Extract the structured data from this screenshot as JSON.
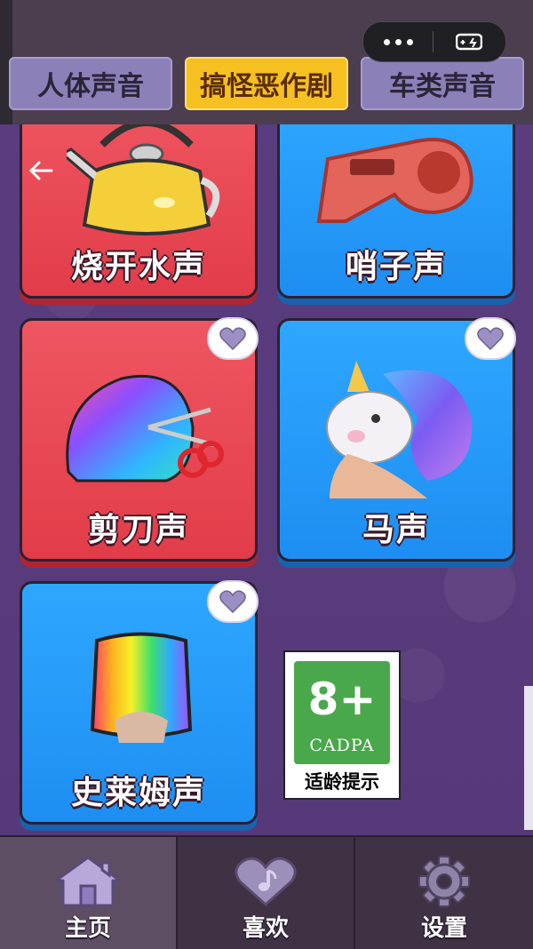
{
  "header": {
    "tabs": [
      {
        "label": "人体声音",
        "active": false
      },
      {
        "label": "搞怪恶作剧",
        "active": true
      },
      {
        "label": "车类声音",
        "active": false
      }
    ],
    "capsule": {
      "menu_icon": "more-dots-icon",
      "close_icon": "gamepad-close-icon"
    }
  },
  "cards": [
    {
      "label": "烧开水声",
      "color": "red",
      "icon": "kettle-icon"
    },
    {
      "label": "哨子声",
      "color": "blue",
      "icon": "whistle-icon"
    },
    {
      "label": "剪刀声",
      "color": "red",
      "icon": "scissors-icon"
    },
    {
      "label": "马声",
      "color": "blue",
      "icon": "unicorn-icon"
    },
    {
      "label": "史莱姆声",
      "color": "blue",
      "icon": "slime-icon"
    }
  ],
  "rating": {
    "age": "8+",
    "org": "CADPA",
    "text": "适龄提示"
  },
  "nav": {
    "items": [
      {
        "label": "主页",
        "icon": "home-icon",
        "active": true
      },
      {
        "label": "喜欢",
        "icon": "heart-music-icon",
        "active": false
      },
      {
        "label": "设置",
        "icon": "gear-icon",
        "active": false
      }
    ]
  },
  "colors": {
    "accent": "#f6c021",
    "red_card": "#e54350",
    "blue_card": "#2196f3",
    "bg": "#5b3f7e"
  }
}
